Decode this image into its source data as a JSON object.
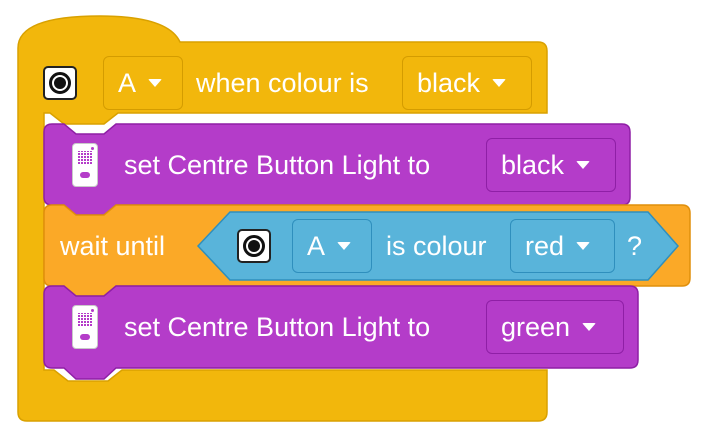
{
  "colors": {
    "event_block": "#f2b70c",
    "hub_block": "#b43cc9",
    "control_block": "#fba927",
    "sensor_block": "#59b4da"
  },
  "event": {
    "icon": "color-sensor-icon",
    "port": "A",
    "label": "when colour is",
    "colour": "black"
  },
  "light1": {
    "icon": "hub-icon",
    "label": "set Centre Button Light to",
    "colour": "black"
  },
  "wait": {
    "label": "wait until",
    "condition": {
      "icon": "color-sensor-icon",
      "port": "A",
      "label": "is colour",
      "colour": "red",
      "suffix": "?"
    }
  },
  "light2": {
    "icon": "hub-icon",
    "label": "set Centre Button Light to",
    "colour": "green"
  }
}
